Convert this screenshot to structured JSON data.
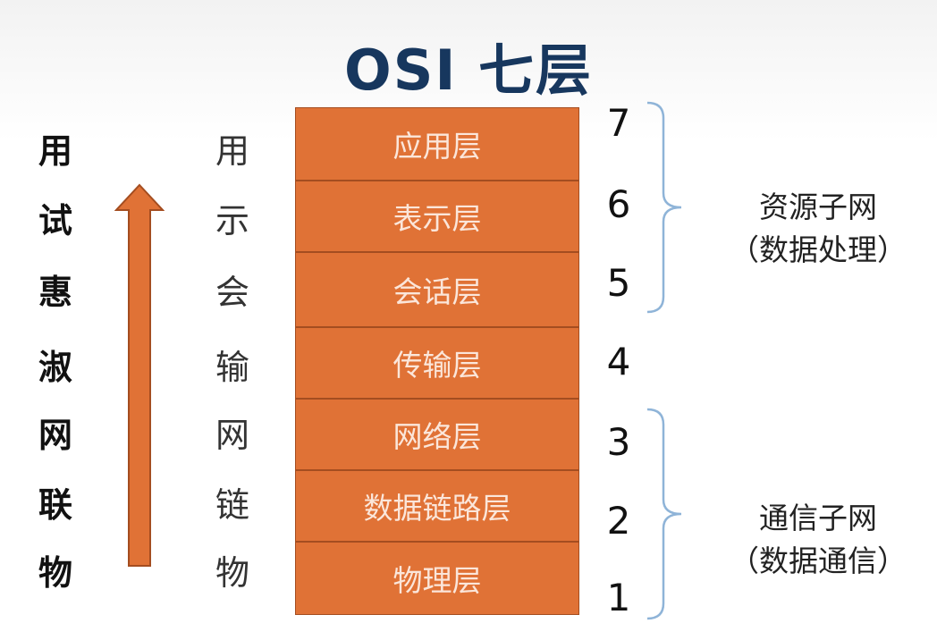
{
  "title": "OSI 七层",
  "mnemonic_left": [
    "用",
    "试",
    "惠",
    "淑",
    "网",
    "联",
    "物"
  ],
  "mnemonic_mid": [
    "用",
    "示",
    "会",
    "输",
    "网",
    "链",
    "物"
  ],
  "layers": [
    {
      "name": "应用层",
      "number": "7"
    },
    {
      "name": "表示层",
      "number": "6"
    },
    {
      "name": "会话层",
      "number": "5"
    },
    {
      "name": "传输层",
      "number": "4"
    },
    {
      "name": "网络层",
      "number": "3"
    },
    {
      "name": "数据链路层",
      "number": "2"
    },
    {
      "name": "物理层",
      "number": "1"
    }
  ],
  "resource_subnet": {
    "line1": "资源子网",
    "line2": "（数据处理）"
  },
  "comm_subnet": {
    "line1": "通信子网",
    "line2": "（数据通信）"
  },
  "colors": {
    "title": "#17375e",
    "layer_fill": "#e07236",
    "layer_text": "#fbe6da",
    "arrow_fill": "#e07236",
    "brace": "#8fb4d8"
  }
}
